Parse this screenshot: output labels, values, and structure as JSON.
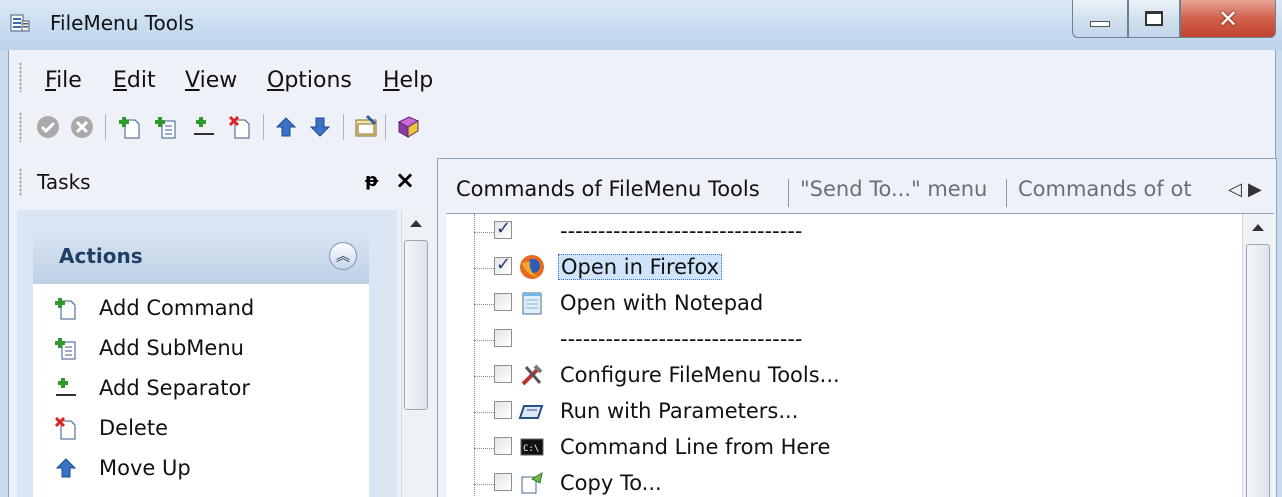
{
  "window": {
    "title": "FileMenu Tools",
    "title_icon": "app-list-icon"
  },
  "menubar": {
    "items": [
      {
        "key": "F",
        "rest": "ile"
      },
      {
        "key": "E",
        "rest": "dit"
      },
      {
        "key": "V",
        "rest": "iew"
      },
      {
        "key": "O",
        "rest": "ptions"
      },
      {
        "key": "H",
        "rest": "elp"
      }
    ]
  },
  "toolbar": {
    "icons": [
      "apply-icon",
      "cancel-icon",
      "add-command-icon",
      "add-submenu-icon",
      "add-separator-icon",
      "delete-icon",
      "move-up-icon",
      "move-down-icon",
      "properties-icon",
      "help-book-icon"
    ]
  },
  "tasks": {
    "header": "Tasks",
    "pin_glyph": "ᵽ",
    "close_glyph": "×",
    "group_title": "Actions",
    "actions": [
      {
        "label": "Add Command",
        "icon": "add-command-icon"
      },
      {
        "label": "Add SubMenu",
        "icon": "add-submenu-icon"
      },
      {
        "label": "Add Separator",
        "icon": "add-separator-icon"
      },
      {
        "label": "Delete",
        "icon": "delete-icon"
      },
      {
        "label": "Move Up",
        "icon": "move-up-icon"
      }
    ]
  },
  "tabs": [
    {
      "label": "Commands of FileMenu Tools",
      "active": true
    },
    {
      "label": "\"Send To...\" menu",
      "active": false
    },
    {
      "label": "Commands of ot",
      "active": false
    }
  ],
  "tree": {
    "rows": [
      {
        "label": "--------------------------------",
        "checked": true,
        "icon": ""
      },
      {
        "label": "Open in Firefox",
        "checked": true,
        "icon": "firefox-icon",
        "selected": true
      },
      {
        "label": "Open with Notepad",
        "checked": false,
        "icon": "notepad-icon"
      },
      {
        "label": "--------------------------------",
        "checked": false,
        "icon": ""
      },
      {
        "label": "Configure FileMenu Tools...",
        "checked": false,
        "icon": "tools-icon"
      },
      {
        "label": "Run with Parameters...",
        "checked": false,
        "icon": "run-parameters-icon"
      },
      {
        "label": "Command Line from Here",
        "checked": false,
        "icon": "console-icon"
      },
      {
        "label": "Copy To...",
        "checked": false,
        "icon": "copy-to-icon"
      }
    ]
  },
  "colors": {
    "selection": "#cfe3fb",
    "accent": "#1e3f66",
    "close_button": "#c2412b"
  }
}
